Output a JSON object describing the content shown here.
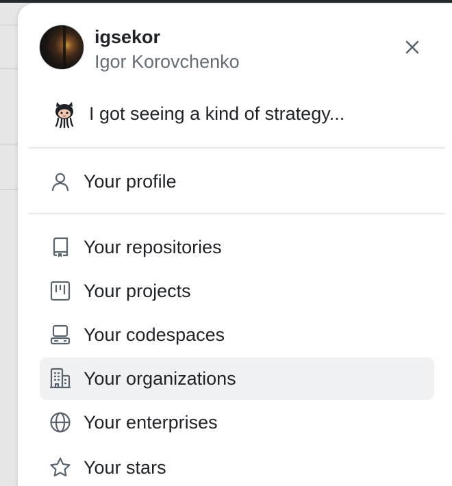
{
  "user": {
    "username": "igsekor",
    "full_name": "Igor Korovchenko"
  },
  "status": {
    "text": "I got seeing a kind of strategy..."
  },
  "menu": {
    "profile": "Your profile",
    "items": [
      {
        "label": "Your repositories",
        "icon": "repo-icon"
      },
      {
        "label": "Your projects",
        "icon": "project-icon"
      },
      {
        "label": "Your codespaces",
        "icon": "codespaces-icon"
      },
      {
        "label": "Your organizations",
        "icon": "organization-icon"
      },
      {
        "label": "Your enterprises",
        "icon": "globe-icon"
      },
      {
        "label": "Your stars",
        "icon": "star-icon"
      }
    ]
  },
  "colors": {
    "text": "#1f2328",
    "muted": "#656d76",
    "hover": "#f0f1f3"
  }
}
